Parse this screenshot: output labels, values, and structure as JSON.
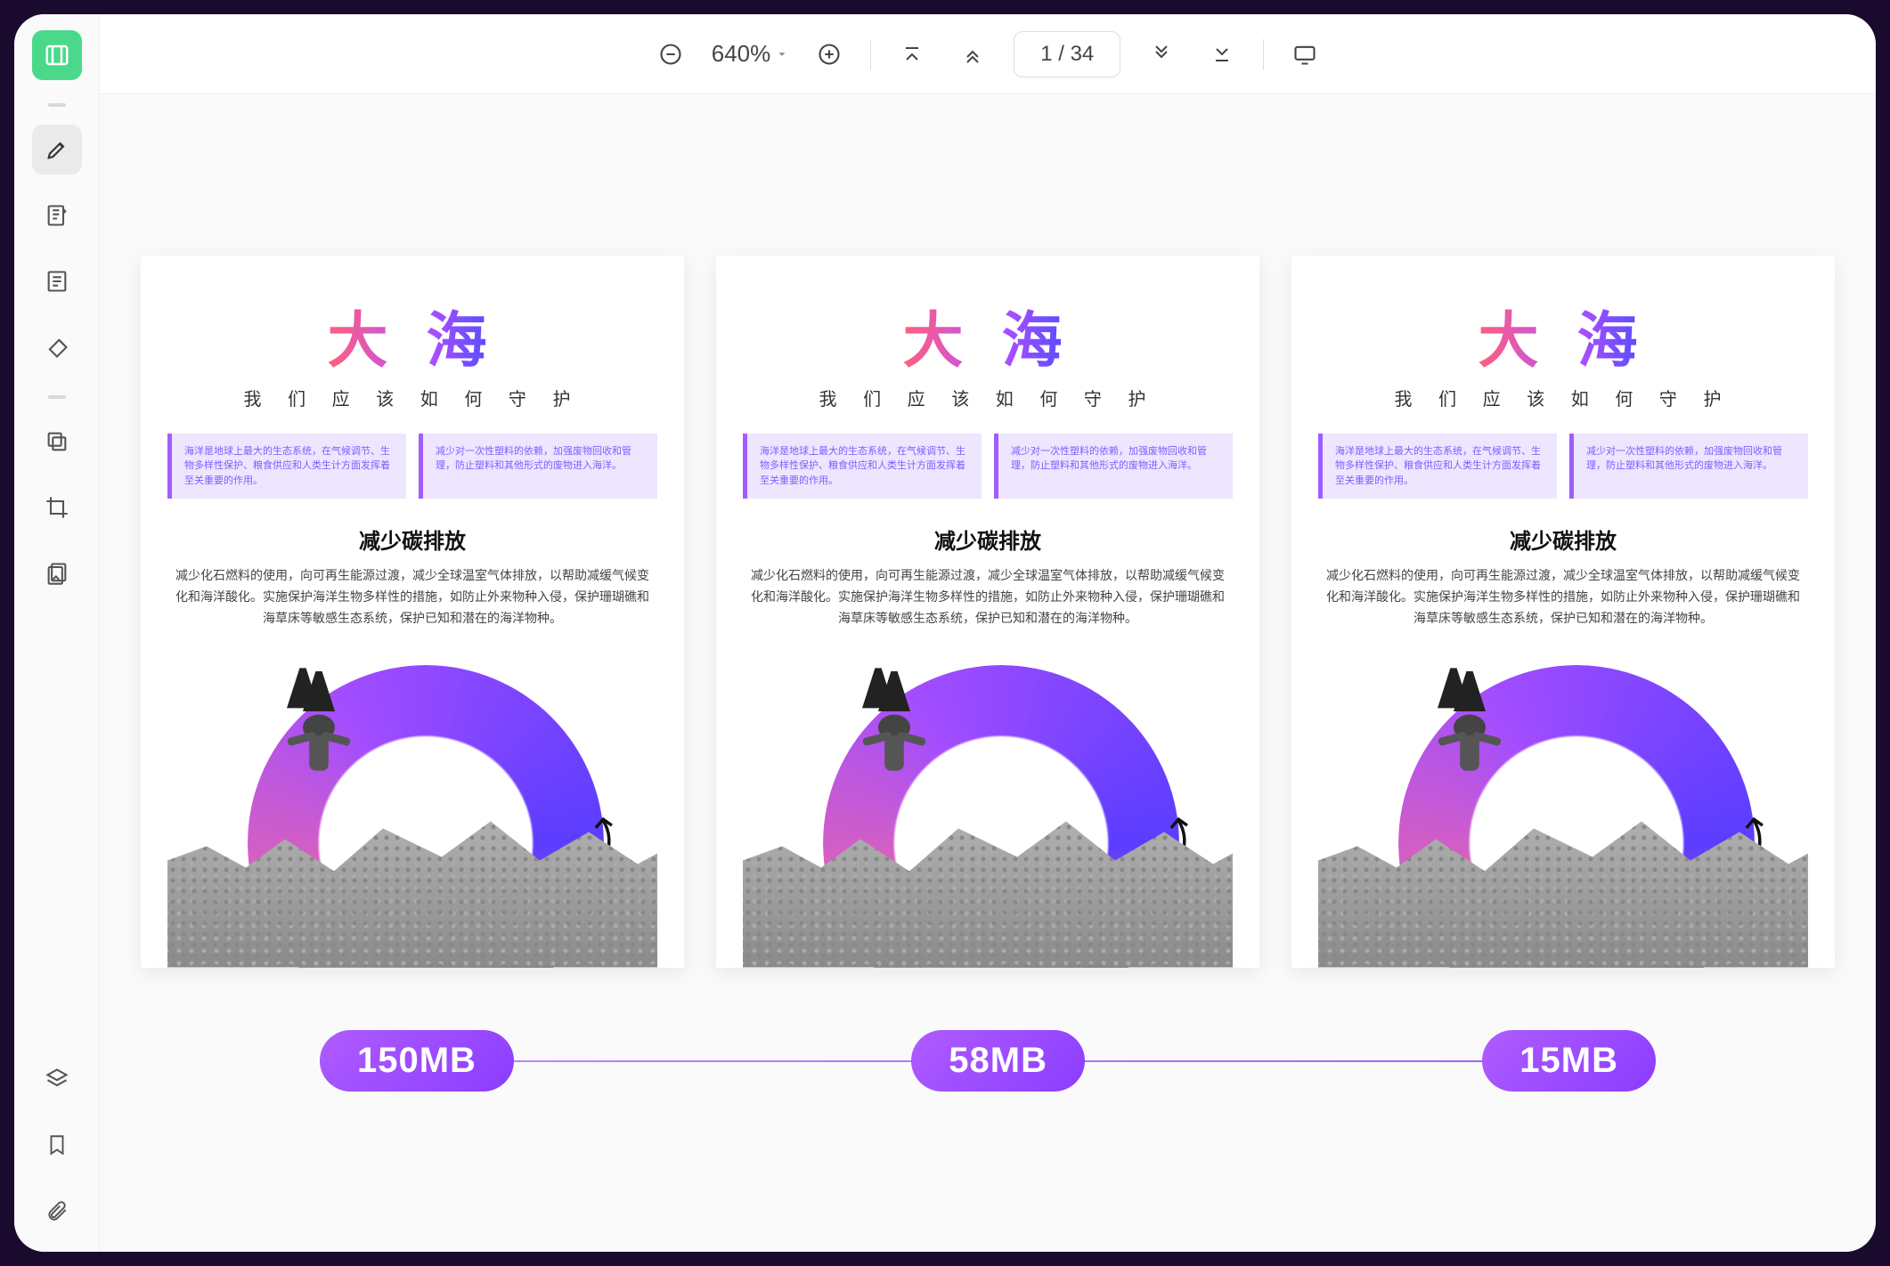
{
  "toolbar": {
    "zoom": "640%",
    "page_display": "1 / 34"
  },
  "documents": [
    {
      "title": "大 海",
      "subtitle": "我 们 应 该 如 何 守 护",
      "box1": "海洋是地球上最大的生态系统，在气候调节、生物多样性保护、粮食供应和人类生计方面发挥着至关重要的作用。",
      "box2": "减少对一次性塑料的依赖，加强废物回收和管理，防止塑料和其他形式的废物进入海洋。",
      "heading": "减少碳排放",
      "paragraph": "减少化石燃料的使用，向可再生能源过渡，减少全球温室气体排放，以帮助减缓气候变化和海洋酸化。实施保护海洋生物多样性的措施，如防止外来物种入侵，保护珊瑚礁和海草床等敏感生态系统，保护已知和潜在的海洋物种。",
      "badge": "150MB"
    },
    {
      "title": "大 海",
      "subtitle": "我 们 应 该 如 何 守 护",
      "box1": "海洋是地球上最大的生态系统，在气候调节、生物多样性保护、粮食供应和人类生计方面发挥着至关重要的作用。",
      "box2": "减少对一次性塑料的依赖，加强废物回收和管理，防止塑料和其他形式的废物进入海洋。",
      "heading": "减少碳排放",
      "paragraph": "减少化石燃料的使用，向可再生能源过渡，减少全球温室气体排放，以帮助减缓气候变化和海洋酸化。实施保护海洋生物多样性的措施，如防止外来物种入侵，保护珊瑚礁和海草床等敏感生态系统，保护已知和潜在的海洋物种。",
      "badge": "58MB"
    },
    {
      "title": "大 海",
      "subtitle": "我 们 应 该 如 何 守 护",
      "box1": "海洋是地球上最大的生态系统，在气候调节、生物多样性保护、粮食供应和人类生计方面发挥着至关重要的作用。",
      "box2": "减少对一次性塑料的依赖，加强废物回收和管理，防止塑料和其他形式的废物进入海洋。",
      "heading": "减少碳排放",
      "paragraph": "减少化石燃料的使用，向可再生能源过渡，减少全球温室气体排放，以帮助减缓气候变化和海洋酸化。实施保护海洋生物多样性的措施，如防止外来物种入侵，保护珊瑚礁和海草床等敏感生态系统，保护已知和潜在的海洋物种。",
      "badge": "15MB"
    }
  ]
}
